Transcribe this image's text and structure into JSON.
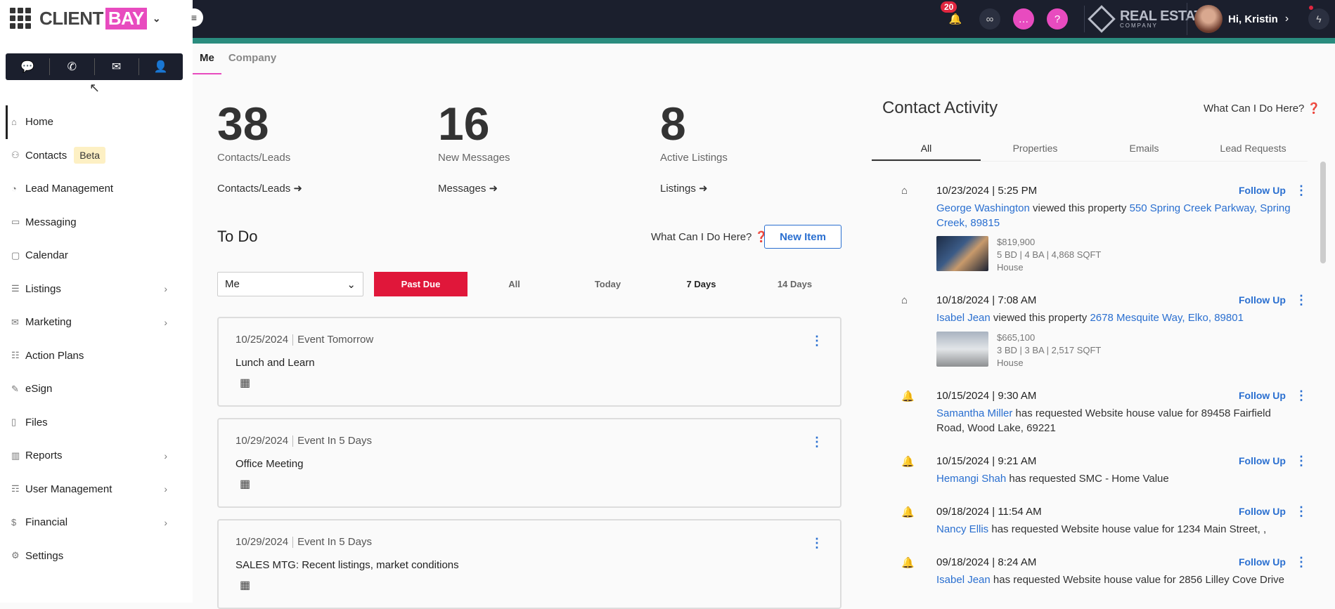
{
  "app": {
    "logo_client": "CLIENT",
    "logo_bay": "BAY",
    "notifications_count": "20",
    "brand_line1": "REAL ESTATE",
    "brand_line2": "COMPANY",
    "greeting": "Hi, Kristin"
  },
  "sidebar": {
    "items": [
      {
        "label": "Home",
        "icon": "home-icon"
      },
      {
        "label": "Contacts",
        "icon": "contacts-icon",
        "badge": "Beta"
      },
      {
        "label": "Lead Management",
        "icon": "lead-icon"
      },
      {
        "label": "Messaging",
        "icon": "message-icon"
      },
      {
        "label": "Calendar",
        "icon": "calendar-icon"
      },
      {
        "label": "Listings",
        "icon": "listings-icon"
      },
      {
        "label": "Marketing",
        "icon": "marketing-icon"
      },
      {
        "label": "Action Plans",
        "icon": "action-plans-icon"
      },
      {
        "label": "eSign",
        "icon": "esign-icon"
      },
      {
        "label": "Files",
        "icon": "files-icon"
      },
      {
        "label": "Reports",
        "icon": "reports-icon"
      },
      {
        "label": "User Management",
        "icon": "user-management-icon"
      },
      {
        "label": "Financial",
        "icon": "financial-icon"
      },
      {
        "label": "Settings",
        "icon": "settings-icon"
      }
    ]
  },
  "tabs": {
    "me": "Me",
    "company": "Company"
  },
  "stats": [
    {
      "value": "38",
      "label": "Contacts/Leads",
      "link": "Contacts/Leads"
    },
    {
      "value": "16",
      "label": "New Messages",
      "link": "Messages"
    },
    {
      "value": "8",
      "label": "Active Listings",
      "link": "Listings"
    }
  ],
  "todo": {
    "title": "To Do",
    "help": "What Can I Do Here?",
    "new_item": "New Item",
    "assignee": "Me",
    "filters": [
      "Past Due",
      "All",
      "Today",
      "7 Days",
      "14 Days"
    ],
    "items": [
      {
        "date": "10/25/2024",
        "type": "Event Tomorrow",
        "title": "Lunch and Learn"
      },
      {
        "date": "10/29/2024",
        "type": "Event In 5 Days",
        "title": "Office Meeting"
      },
      {
        "date": "10/29/2024",
        "type": "Event In 5 Days",
        "title": "SALES MTG: Recent listings, market conditions"
      }
    ]
  },
  "activity": {
    "title": "Contact Activity",
    "help": "What Can I Do Here?",
    "tabs": [
      "All",
      "Properties",
      "Emails",
      "Lead Requests"
    ],
    "follow_up": "Follow Up",
    "items": [
      {
        "date": "10/23/2024",
        "time": "5:25 PM",
        "name": "George Washington",
        "action": " viewed this property ",
        "target": "550 Spring Creek Parkway, Spring Creek, 89815",
        "price": "$819,900",
        "specs": "5 BD | 4 BA | 4,868 SQFT",
        "kind": "House"
      },
      {
        "date": "10/18/2024",
        "time": "7:08 AM",
        "name": "Isabel Jean",
        "action": " viewed this property ",
        "target": "2678 Mesquite Way, Elko, 89801",
        "price": "$665,100",
        "specs": "3 BD | 3 BA | 2,517 SQFT",
        "kind": "House"
      },
      {
        "date": "10/15/2024",
        "time": "9:30 AM",
        "name": "Samantha Miller",
        "action": " has requested Website house value for 89458 Fairfield Road, Wood Lake, 69221"
      },
      {
        "date": "10/15/2024",
        "time": "9:21 AM",
        "name": "Hemangi Shah",
        "action": " has requested SMC - Home Value"
      },
      {
        "date": "09/18/2024",
        "time": "11:54 AM",
        "name": "Nancy Ellis",
        "action": " has requested Website house value for 1234 Main Street, ,"
      },
      {
        "date": "09/18/2024",
        "time": "8:24 AM",
        "name": "Isabel Jean",
        "action": " has requested Website house value for 2856 Lilley Cove Drive"
      }
    ]
  }
}
